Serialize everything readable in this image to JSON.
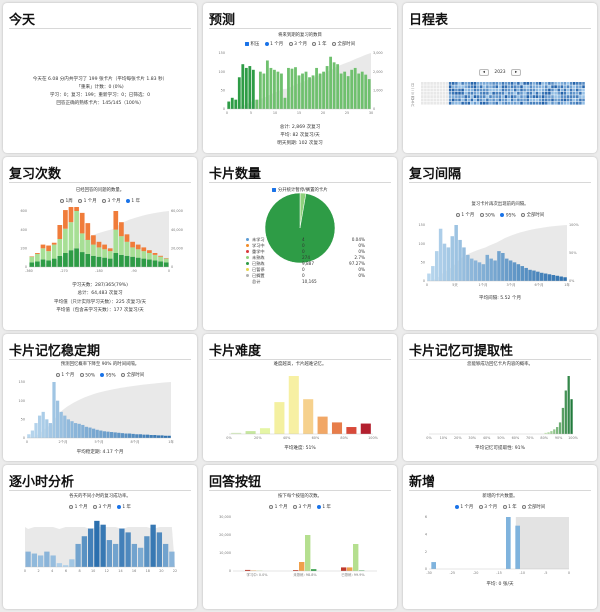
{
  "colors": {
    "accent": "#1a73e8",
    "forecast_young": "#8bd07f",
    "forecast_mature": "#2e9c46",
    "reviews_learn": "#f07c3a",
    "reviews_young": "#a7df95",
    "reviews_mature": "#2e9c46",
    "blue_light": "#b9d7ee",
    "blue_dark": "#2b6fae",
    "area_fill": "#e3e3e3"
  },
  "today": {
    "title": "今天",
    "line1": "今天在 6.08 分内共学习了 199 张卡片（平均每张卡片 1.83 秒）",
    "line2": "「重来」计数：0 (0%)",
    "line3": "学习：0；复习：199；重新学习：0；已筛选：0",
    "line4": "回答正确的熟练卡片：145/145（100%）"
  },
  "forecast": {
    "title": "预测",
    "caption": "将来到期的复习的数目",
    "options": [
      "积压",
      "1 个月",
      "3 个月",
      "1 年",
      "全部时间"
    ],
    "total": "总计: 2,869 次复习",
    "average": "平均: 82 次复习/天",
    "tomorrow": "明天到期: 102 次复习",
    "y_ticks": [
      "150",
      "100",
      "50",
      "0"
    ],
    "r_ticks": [
      "3,000",
      "2,000",
      "1,000",
      "0"
    ],
    "x_ticks": [
      "0",
      "5",
      "10",
      "15",
      "20",
      "25",
      "30"
    ]
  },
  "calendar": {
    "title": "日程表",
    "year": "2023",
    "prev": "◂",
    "next": "▸",
    "weekdays": [
      "日",
      "一",
      "二",
      "三",
      "四",
      "五",
      "六"
    ]
  },
  "review_count": {
    "title": "复习次数",
    "caption": "已经回答的问题的数量。",
    "options": [
      "1周",
      "1 个月",
      "3 个月",
      "1 年"
    ],
    "days_studied": "学习天数：287/365(79%)",
    "total": "总计：64,483 次复习",
    "avg_studied": "平均值（只计实际学习天数）：225 次复习/天",
    "avg_all": "平均值（包含未学习天数）：177 次复习/天",
    "x_ticks": [
      "-360",
      "-330",
      "-300",
      "-270",
      "-240",
      "-210",
      "-180",
      "-150",
      "-120",
      "-90",
      "-60",
      "-30",
      "0"
    ],
    "y_ticks": [
      "600",
      "400",
      "200",
      "0"
    ],
    "r_ticks": [
      "60,000",
      "40,000",
      "20,000",
      "0"
    ]
  },
  "card_count": {
    "title": "卡片数量",
    "checkbox": "分开统计暂停/搁置的卡片",
    "legend": [
      {
        "label": "未学习",
        "count": "4",
        "pct": "0.04%",
        "color": "#5b9bd5"
      },
      {
        "label": "学习中",
        "count": "0",
        "pct": "0%",
        "color": "#f28c28"
      },
      {
        "label": "重学中",
        "count": "0",
        "pct": "0%",
        "color": "#d9383a"
      },
      {
        "label": "未熟练",
        "count": "274",
        "pct": "2.7%",
        "color": "#8fd17c"
      },
      {
        "label": "已熟练",
        "count": "9,887",
        "pct": "97.27%",
        "color": "#2e9c46"
      },
      {
        "label": "已暂停",
        "count": "0",
        "pct": "0%",
        "color": "#e8d44d"
      },
      {
        "label": "已搁置",
        "count": "0",
        "pct": "0%",
        "color": "#b0b0b0"
      }
    ],
    "total_label": "总计",
    "total_value": "10,165"
  },
  "interval": {
    "title": "复习间隔",
    "caption": "复习卡片再次出现前的间隔。",
    "options": [
      "1 个月",
      "50%",
      "95%",
      "全部时间"
    ],
    "average": "平均间隔: 5.52 个月",
    "x_ticks": [
      "0",
      "5天",
      "1个月",
      "3个月",
      "6个月",
      "1年"
    ],
    "y_ticks": [
      "150",
      "100",
      "50",
      "0"
    ],
    "r_ticks": [
      "100%",
      "50%",
      "0%"
    ]
  },
  "stability": {
    "title": "卡片记忆稳定期",
    "caption": "预测回忆概率下降至 90% 的时间间隔。",
    "options": [
      "1 个月",
      "50%",
      "95%",
      "全部时间"
    ],
    "average": "平均稳定期: 4.17 个月",
    "x_ticks": [
      "0",
      "2个月",
      "5个月",
      "8个月",
      "1年"
    ],
    "y_ticks": [
      "150",
      "100",
      "50",
      "0"
    ]
  },
  "difficulty": {
    "title": "卡片难度",
    "caption": "难度越高，卡片越难记忆。",
    "average": "平均难度: 51%",
    "x_ticks": [
      "0%",
      "20%",
      "40%",
      "60%",
      "80%",
      "100%"
    ]
  },
  "retrievability": {
    "title": "卡片记忆可提取性",
    "caption": "您能够成功回忆卡片内容的概率。",
    "average": "平均记忆可提取性: 91%",
    "x_ticks": [
      "0%",
      "10%",
      "20%",
      "30%",
      "40%",
      "50%",
      "60%",
      "70%",
      "80%",
      "90%",
      "100%"
    ]
  },
  "hourly": {
    "title": "逐小时分析",
    "caption": "各天的不同小时的复习成功率。",
    "options": [
      "1 个月",
      "3 个月",
      "1 年"
    ],
    "x_ticks": [
      "0",
      "1",
      "2",
      "3",
      "4",
      "5",
      "6",
      "7",
      "8",
      "9",
      "10",
      "11",
      "12",
      "13",
      "14",
      "15",
      "16",
      "17",
      "18",
      "19",
      "20",
      "21",
      "22",
      "23"
    ]
  },
  "buttons": {
    "title": "回答按钮",
    "caption": "按下每个按钮的次数。",
    "options": [
      "1 个月",
      "3 个月",
      "1 年"
    ],
    "groups": [
      "学习中: 0.0%",
      "未熟练: 98.8%",
      "已熟练: 99.9%"
    ],
    "y_ticks": [
      "30,000",
      "20,000",
      "10,000",
      "0"
    ]
  },
  "added": {
    "title": "新增",
    "caption": "新增的卡片数量。",
    "options": [
      "1 个月",
      "3 个月",
      "1 年",
      "全部时间"
    ],
    "average": "平均: 0 张/天",
    "x_ticks": [
      "-30",
      "-25",
      "-20",
      "-15",
      "-10",
      "-5",
      "0"
    ],
    "y_ticks": [
      "6",
      "4",
      "2",
      "0"
    ]
  },
  "chart_data": [
    {
      "id": "forecast",
      "type": "bar",
      "x": [
        0,
        1,
        2,
        3,
        4,
        5,
        6,
        7,
        8,
        9,
        10,
        11,
        12,
        13,
        14,
        15,
        16,
        17,
        18,
        19,
        20,
        21,
        22,
        23,
        24,
        25,
        26,
        27,
        28,
        29,
        30,
        31,
        32,
        33,
        34,
        35,
        36,
        37,
        38,
        39,
        40
      ],
      "series": [
        {
          "values": [
            20,
            30,
            25,
            85,
            120,
            110,
            115,
            105,
            25,
            100,
            95,
            130,
            110,
            105,
            100,
            95,
            30,
            110,
            108,
            112,
            90,
            95,
            100,
            85,
            90,
            110,
            95,
            100,
            115,
            140,
            125,
            120,
            95,
            100,
            88,
            105,
            110,
            95,
            100,
            92,
            80
          ]
        }
      ],
      "ylim": [
        0,
        150
      ]
    },
    {
      "id": "review_count",
      "type": "area",
      "series": [
        {
          "name": "学习",
          "values": [
            5,
            10,
            40,
            60,
            20,
            150,
            200,
            250,
            150,
            220,
            180,
            100,
            60,
            50,
            30,
            200,
            150,
            80,
            60,
            50,
            40,
            30,
            20,
            10,
            5
          ]
        },
        {
          "name": "未熟练",
          "values": [
            60,
            80,
            120,
            100,
            150,
            180,
            260,
            300,
            400,
            200,
            150,
            120,
            100,
            90,
            80,
            250,
            200,
            150,
            100,
            90,
            80,
            70,
            60,
            50,
            40
          ]
        },
        {
          "name": "已熟练",
          "values": [
            50,
            60,
            80,
            70,
            90,
            120,
            150,
            180,
            200,
            160,
            140,
            120,
            110,
            100,
            90,
            150,
            130,
            120,
            110,
            100,
            90,
            80,
            70,
            60,
            50
          ]
        }
      ],
      "ylim": [
        0,
        600
      ]
    },
    {
      "id": "card_count",
      "type": "pie",
      "categories": [
        "未学习",
        "学习中",
        "重学中",
        "未熟练",
        "已熟练",
        "已暂停",
        "已搁置"
      ],
      "values": [
        4,
        0,
        0,
        274,
        9887,
        0,
        0
      ]
    },
    {
      "id": "interval",
      "type": "bar",
      "values": [
        20,
        40,
        80,
        140,
        100,
        90,
        120,
        150,
        110,
        90,
        70,
        60,
        55,
        50,
        45,
        70,
        60,
        55,
        80,
        75,
        60,
        55,
        50,
        45,
        40,
        35,
        30,
        28,
        25,
        22,
        20,
        18,
        16,
        14,
        12,
        10
      ],
      "ylim": [
        0,
        150
      ]
    },
    {
      "id": "stability",
      "type": "bar",
      "values": [
        10,
        20,
        40,
        60,
        70,
        50,
        40,
        150,
        100,
        70,
        60,
        50,
        45,
        40,
        38,
        35,
        30,
        28,
        25,
        22,
        20,
        18,
        17,
        16,
        15,
        14,
        13,
        12,
        12,
        11,
        10,
        10,
        9,
        9,
        8,
        8,
        7,
        7,
        6,
        6
      ],
      "ylim": [
        0,
        150
      ]
    },
    {
      "id": "difficulty",
      "type": "bar",
      "categories": [
        "0%",
        "10%",
        "20%",
        "30%",
        "40%",
        "50%",
        "60%",
        "70%",
        "80%",
        "90%"
      ],
      "values": [
        2,
        5,
        10,
        55,
        100,
        60,
        30,
        20,
        12,
        18
      ]
    },
    {
      "id": "retrievability",
      "type": "bar",
      "categories": [
        "80%",
        "82%",
        "84%",
        "86%",
        "88%",
        "90%",
        "92%",
        "94%",
        "96%",
        "98%"
      ],
      "values": [
        2,
        3,
        5,
        8,
        12,
        20,
        45,
        75,
        100,
        60
      ]
    },
    {
      "id": "hourly",
      "type": "bar",
      "categories": [
        "0",
        "1",
        "2",
        "3",
        "4",
        "5",
        "6",
        "7",
        "8",
        "9",
        "10",
        "11",
        "12",
        "13",
        "14",
        "15",
        "16",
        "17",
        "18",
        "19",
        "20",
        "21",
        "22",
        "23"
      ],
      "values": [
        40,
        35,
        30,
        40,
        30,
        10,
        5,
        20,
        60,
        80,
        100,
        120,
        110,
        70,
        60,
        100,
        90,
        60,
        50,
        80,
        110,
        90,
        60,
        40
      ]
    },
    {
      "id": "buttons",
      "type": "bar",
      "categories": [
        "学习中",
        "未熟练",
        "已熟练"
      ],
      "series": [
        {
          "name": "重来",
          "values": [
            0.6,
            0.5,
            2.0
          ]
        },
        {
          "name": "困难",
          "values": [
            0.3,
            5.0,
            2.0
          ]
        },
        {
          "name": "良好",
          "values": [
            0.2,
            20.0,
            15.0
          ]
        },
        {
          "name": "简单",
          "values": [
            0,
            1.0,
            0.3
          ]
        }
      ],
      "ylim": [
        0,
        30000
      ]
    },
    {
      "id": "added",
      "type": "bar",
      "x": [
        -30,
        -25,
        -20,
        -15,
        -10,
        -5,
        0
      ],
      "values": [
        0,
        0,
        0,
        1,
        0,
        0,
        0
      ],
      "ylim": [
        0,
        6
      ]
    }
  ]
}
